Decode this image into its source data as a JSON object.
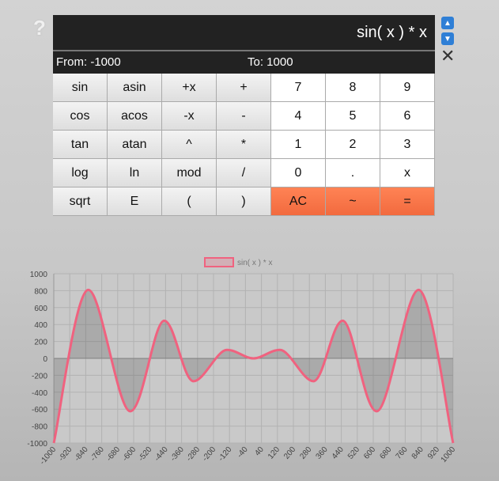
{
  "help_label": "?",
  "display": "sin( x ) * x",
  "range": {
    "from_label": "From: -1000",
    "to_label": "To: 1000"
  },
  "keys": [
    {
      "label": "sin",
      "kind": "fn",
      "name": "sin"
    },
    {
      "label": "asin",
      "kind": "fn",
      "name": "asin"
    },
    {
      "label": "+x",
      "kind": "fn",
      "name": "plus-x"
    },
    {
      "label": "+",
      "kind": "fn",
      "name": "plus"
    },
    {
      "label": "7",
      "kind": "num",
      "name": "7"
    },
    {
      "label": "8",
      "kind": "num",
      "name": "8"
    },
    {
      "label": "9",
      "kind": "num",
      "name": "9"
    },
    {
      "label": "cos",
      "kind": "fn",
      "name": "cos"
    },
    {
      "label": "acos",
      "kind": "fn",
      "name": "acos"
    },
    {
      "label": "-x",
      "kind": "fn",
      "name": "minus-x"
    },
    {
      "label": "-",
      "kind": "fn",
      "name": "minus"
    },
    {
      "label": "4",
      "kind": "num",
      "name": "4"
    },
    {
      "label": "5",
      "kind": "num",
      "name": "5"
    },
    {
      "label": "6",
      "kind": "num",
      "name": "6"
    },
    {
      "label": "tan",
      "kind": "fn",
      "name": "tan"
    },
    {
      "label": "atan",
      "kind": "fn",
      "name": "atan"
    },
    {
      "label": "^",
      "kind": "fn",
      "name": "power"
    },
    {
      "label": "*",
      "kind": "fn",
      "name": "multiply"
    },
    {
      "label": "1",
      "kind": "num",
      "name": "1"
    },
    {
      "label": "2",
      "kind": "num",
      "name": "2"
    },
    {
      "label": "3",
      "kind": "num",
      "name": "3"
    },
    {
      "label": "log",
      "kind": "fn",
      "name": "log"
    },
    {
      "label": "ln",
      "kind": "fn",
      "name": "ln"
    },
    {
      "label": "mod",
      "kind": "fn",
      "name": "mod"
    },
    {
      "label": "/",
      "kind": "fn",
      "name": "divide"
    },
    {
      "label": "0",
      "kind": "num",
      "name": "0"
    },
    {
      "label": ".",
      "kind": "num",
      "name": "decimal"
    },
    {
      "label": "x",
      "kind": "num",
      "name": "x"
    },
    {
      "label": "sqrt",
      "kind": "fn",
      "name": "sqrt"
    },
    {
      "label": "E",
      "kind": "fn",
      "name": "e"
    },
    {
      "label": "(",
      "kind": "fn",
      "name": "open-paren"
    },
    {
      "label": ")",
      "kind": "fn",
      "name": "close-paren"
    },
    {
      "label": "AC",
      "kind": "op",
      "name": "ac"
    },
    {
      "label": "~",
      "kind": "op",
      "name": "approx"
    },
    {
      "label": "=",
      "kind": "op",
      "name": "equals"
    }
  ],
  "icons": {
    "up": "up-arrow-icon",
    "down": "down-arrow-icon",
    "close": "close-icon"
  },
  "colors": {
    "accent": "#f26a3e",
    "series": "#f0627f",
    "arrow": "#2f7fd6",
    "display_bg": "#222222"
  },
  "chart_data": {
    "type": "area",
    "series": [
      {
        "name": "sin( x ) * x"
      }
    ],
    "function": "sin(x) * x",
    "x_range": [
      -1000,
      1000
    ],
    "ylim": [
      -1000,
      1000
    ],
    "x_ticks": [
      -1000,
      -920,
      -840,
      -760,
      -680,
      -600,
      -520,
      -440,
      -360,
      -280,
      -200,
      -120,
      -40,
      40,
      120,
      200,
      280,
      360,
      440,
      520,
      600,
      680,
      760,
      840,
      920,
      1000
    ],
    "y_ticks": [
      1000,
      800,
      600,
      400,
      200,
      0,
      -200,
      -400,
      -600,
      -800,
      -1000
    ],
    "points": [
      {
        "x": -1000,
        "y": -1000
      },
      {
        "x": -827,
        "y": 810
      },
      {
        "x": -617,
        "y": -625
      },
      {
        "x": -447,
        "y": 445
      },
      {
        "x": -300,
        "y": -270
      },
      {
        "x": -133,
        "y": 100
      },
      {
        "x": 0,
        "y": 0
      },
      {
        "x": 133,
        "y": 100
      },
      {
        "x": 300,
        "y": -270
      },
      {
        "x": 447,
        "y": 445
      },
      {
        "x": 617,
        "y": -625
      },
      {
        "x": 827,
        "y": 810
      },
      {
        "x": 1000,
        "y": -1000
      }
    ],
    "grid": true,
    "legend": "top-center"
  }
}
